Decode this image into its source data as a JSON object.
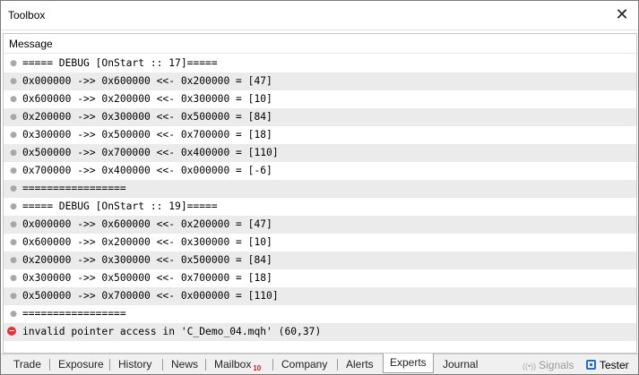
{
  "window": {
    "title": "Toolbox",
    "close_glyph": "✕"
  },
  "panel": {
    "header": "Message"
  },
  "log": [
    {
      "text": "===== DEBUG [OnStart :: 17]=====",
      "level": "info"
    },
    {
      "text": "0x000000 ->> 0x600000 <<- 0x200000 = [47]",
      "level": "info"
    },
    {
      "text": "0x600000 ->> 0x200000 <<- 0x300000 = [10]",
      "level": "info"
    },
    {
      "text": "0x200000 ->> 0x300000 <<- 0x500000 = [84]",
      "level": "info"
    },
    {
      "text": "0x300000 ->> 0x500000 <<- 0x700000 = [18]",
      "level": "info"
    },
    {
      "text": "0x500000 ->> 0x700000 <<- 0x400000 = [110]",
      "level": "info"
    },
    {
      "text": "0x700000 ->> 0x400000 <<- 0x000000 = [-6]",
      "level": "info"
    },
    {
      "text": "=================",
      "level": "info"
    },
    {
      "text": "===== DEBUG [OnStart :: 19]=====",
      "level": "info"
    },
    {
      "text": "0x000000 ->> 0x600000 <<- 0x200000 = [47]",
      "level": "info"
    },
    {
      "text": "0x600000 ->> 0x200000 <<- 0x300000 = [10]",
      "level": "info"
    },
    {
      "text": "0x200000 ->> 0x300000 <<- 0x500000 = [84]",
      "level": "info"
    },
    {
      "text": "0x300000 ->> 0x500000 <<- 0x700000 = [18]",
      "level": "info"
    },
    {
      "text": "0x500000 ->> 0x700000 <<- 0x000000 = [110]",
      "level": "info"
    },
    {
      "text": "=================",
      "level": "info"
    },
    {
      "text": "invalid pointer access in 'C_Demo_04.mqh' (60,37)",
      "level": "error"
    }
  ],
  "tabs": {
    "trade": "Trade",
    "exposure": "Exposure",
    "history": "History",
    "news": "News",
    "mailbox": "Mailbox",
    "mailbox_badge": "10",
    "company": "Company",
    "alerts": "Alerts",
    "experts": "Experts",
    "journal": "Journal",
    "active": "Experts"
  },
  "status": {
    "signals": "Signals",
    "tester": "Tester"
  },
  "icons": {
    "info_marker": "info-dot-icon",
    "error_marker": "error-circle-icon",
    "signals": "signal-waves-icon",
    "tester": "chip-icon"
  },
  "colors": {
    "error": "#e0343b",
    "tester_accent": "#1e6fc8",
    "badge": "#d4141b"
  }
}
